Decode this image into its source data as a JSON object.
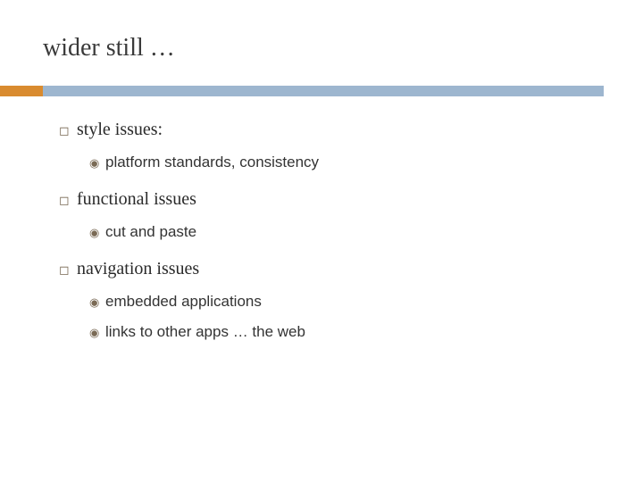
{
  "title": "wider still …",
  "glyphs": {
    "square": "◻",
    "target": "◉"
  },
  "items": [
    {
      "text": "style issues:",
      "children": [
        {
          "text": "platform standards,  consistency"
        }
      ]
    },
    {
      "text": "functional issues",
      "children": [
        {
          "text": "cut and paste"
        }
      ]
    },
    {
      "text": "navigation issues",
      "children": [
        {
          "text": "embedded applications"
        },
        {
          "text": "links to other apps  … the web"
        }
      ]
    }
  ]
}
